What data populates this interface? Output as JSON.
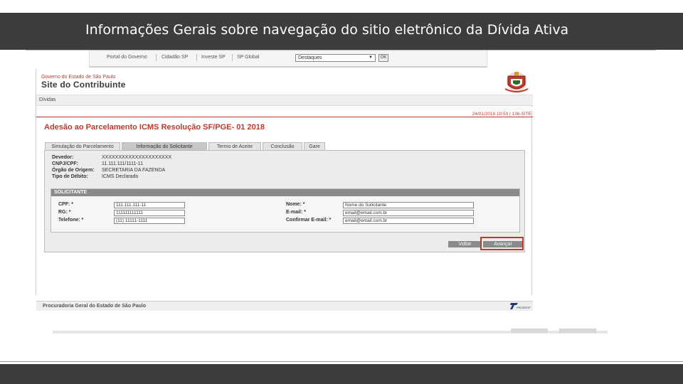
{
  "slide": {
    "title": "Informações Gerais sobre navegação do sitio eletrônico da Dívida Ativa"
  },
  "portal": {
    "links": [
      "Portal do Governo",
      "Cidadão SP",
      "Investe SP",
      "SP Global"
    ],
    "select_value": "Destaques",
    "ok_label": "OK"
  },
  "site": {
    "gov_label": "Governo do Estado de São Paulo",
    "title": "Site do Contribuinte",
    "breadcrumb": "Dívidas",
    "timestamp": "24/01/2019 10:53 | 136-SITE",
    "page_heading": "Adesão ao Parcelamento ICMS Resolução SF/PGE- 01 2018",
    "tabs": [
      "Simulação do Parcelamento",
      "Informação do Solicitante",
      "Termo de Aceite",
      "Conclusão",
      "Gare"
    ],
    "active_tab_index": 1,
    "info": [
      {
        "label": "Devedor:",
        "value": "XXXXXXXXXXXXXXXXXXXXX"
      },
      {
        "label": "CNPJ/CPF:",
        "value": "11.111.111/1111-11"
      },
      {
        "label": "Órgão de Origem:",
        "value": "SECRETARIA DA FAZENDA"
      },
      {
        "label": "Tipo de Débito:",
        "value": "ICMS Declarado"
      }
    ],
    "solicitante": {
      "title": "SOLICITANTE",
      "cpf": {
        "label": "CPF: *",
        "value": "111.111.111-11"
      },
      "rg": {
        "label": "RG: *",
        "value": "111111111111"
      },
      "telefone": {
        "label": "Telefone: *",
        "value": "(11) 11111-1111"
      },
      "nome": {
        "label": "Nome: *",
        "value": "Nome do Solicitante"
      },
      "email": {
        "label": "E-mail: *",
        "value": "email@email.com.br"
      },
      "confirmar_email": {
        "label": "Confirmar E-mail: *",
        "value": "email@email.com.br"
      }
    },
    "buttons": {
      "voltar": "Voltar",
      "avancar": "Avançar"
    },
    "footer": "Procuradoria Geral do Estado de São Paulo",
    "footer_logo": "PRODESP"
  },
  "colors": {
    "band": "#3d3d3d",
    "accent_red": "#c0392b"
  }
}
